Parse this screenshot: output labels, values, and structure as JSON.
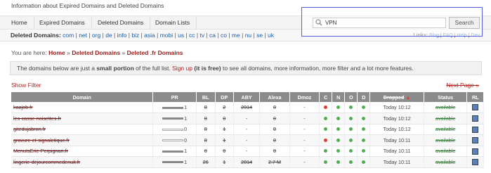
{
  "header": {
    "tagline": "Information about Expired Domains and Deleted Domains"
  },
  "nav": {
    "tabs": [
      "Home",
      "Expired Domains",
      "Deleted Domains",
      "Domain Lists"
    ]
  },
  "domains_bar": {
    "label": "Deleted Domains:",
    "tlds": [
      "com",
      "net",
      "org",
      "de",
      "info",
      "biz",
      "asia",
      "mobi",
      "us",
      "cc",
      "tv",
      "ca",
      "co",
      "me",
      "nu",
      "se",
      "uk"
    ],
    "links_label": "Links:",
    "links": [
      "Blog",
      "FAQ",
      "Help",
      "Dev"
    ]
  },
  "search": {
    "value": "VPN",
    "button": "Search"
  },
  "breadcrumb": {
    "prefix": "You are here:",
    "items": [
      "Home",
      "Deleted Domains",
      "Deleted .fr Domains"
    ],
    "sep": "»"
  },
  "notice": {
    "p1": "The domains below are just a ",
    "bold": "small portion",
    "p2": " of the full list. ",
    "signup": "Sign up",
    "free": "(it is free)",
    "p3": " to see all domains, more information, more filter and a lot more features."
  },
  "filter_label": "Show Filter",
  "next_label": "Next Page »",
  "columns": [
    "Domain",
    "PR",
    "BL",
    "DP",
    "ABY",
    "Alexa",
    "Dmoz",
    "C",
    "N",
    "O",
    "D",
    "Dropped",
    "Status",
    "RL"
  ],
  "rows": [
    {
      "domain": "kaajob.fr",
      "pr": "1",
      "bl": "0",
      "dp": "2",
      "aby": "2014",
      "alexa": "0",
      "dmoz": "-",
      "c": "r",
      "n": "g",
      "o": "g",
      "d": "g",
      "dropped": "Today 10:12",
      "status": "available"
    },
    {
      "domain": "les-casse-noisettes.fr",
      "pr": "1",
      "bl": "0",
      "dp": "0",
      "aby": "-",
      "alexa": "0",
      "dmoz": "-",
      "c": "g",
      "n": "g",
      "o": "g",
      "d": "g",
      "dropped": "Today 10:12",
      "status": "available"
    },
    {
      "domain": "gitedujabron.fr",
      "pr": "0",
      "bl": "0",
      "dp": "1",
      "aby": "-",
      "alexa": "0",
      "dmoz": "-",
      "c": "g",
      "n": "g",
      "o": "g",
      "d": "g",
      "dropped": "Today 10:12",
      "status": "available"
    },
    {
      "domain": "gravure-et-signaletique.fr",
      "pr": "0",
      "bl": "0",
      "dp": "1",
      "aby": "-",
      "alexa": "0",
      "dmoz": "-",
      "c": "r",
      "n": "g",
      "o": "g",
      "d": "g",
      "dropped": "Today 10:11",
      "status": "available"
    },
    {
      "domain": "MenuIsErie-Perpignan.fr",
      "pr": "1",
      "bl": "0",
      "dp": "0",
      "aby": "-",
      "alexa": "0",
      "dmoz": "-",
      "c": "g",
      "n": "g",
      "o": "g",
      "d": "g",
      "dropped": "Today 10:11",
      "status": "available"
    },
    {
      "domain": "lingerie-dejourcommedenuit.fr",
      "pr": "1",
      "bl": "26",
      "dp": "1",
      "aby": "2014",
      "alexa": "2.7 M",
      "dmoz": "-",
      "c": "g",
      "n": "g",
      "o": "g",
      "d": "g",
      "dropped": "Today 10:11",
      "status": "available"
    }
  ],
  "pr_empty": [
    false,
    false,
    true,
    true,
    false,
    false
  ]
}
